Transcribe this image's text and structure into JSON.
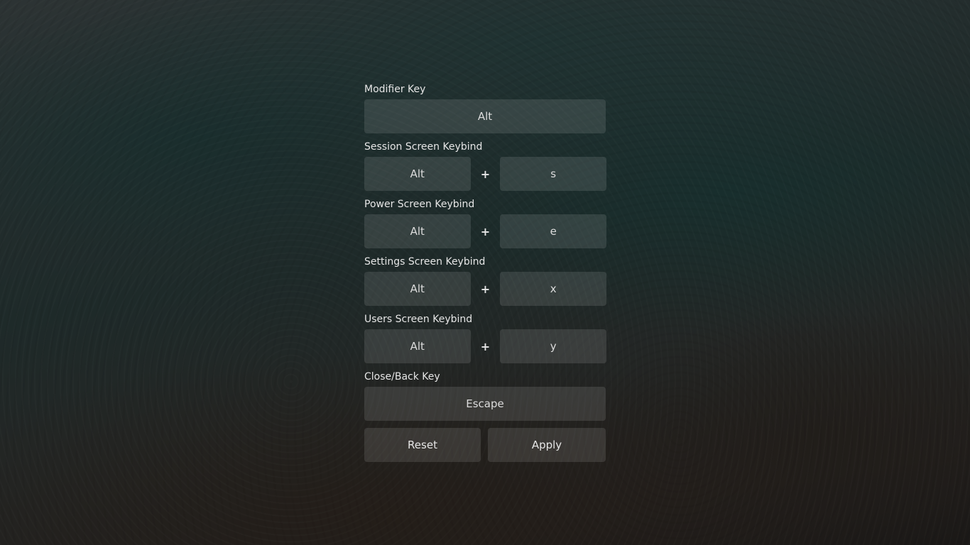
{
  "modifier": {
    "label": "Modifier Key",
    "value": "Alt"
  },
  "keybinds": [
    {
      "label": "Session Screen Keybind",
      "modifier": "Alt",
      "plus": "+",
      "key": "s"
    },
    {
      "label": "Power Screen Keybind",
      "modifier": "Alt",
      "plus": "+",
      "key": "e"
    },
    {
      "label": "Settings Screen Keybind",
      "modifier": "Alt",
      "plus": "+",
      "key": "x"
    },
    {
      "label": "Users Screen Keybind",
      "modifier": "Alt",
      "plus": "+",
      "key": "y"
    }
  ],
  "close_key": {
    "label": "Close/Back Key",
    "value": "Escape"
  },
  "actions": {
    "reset_label": "Reset",
    "apply_label": "Apply"
  }
}
